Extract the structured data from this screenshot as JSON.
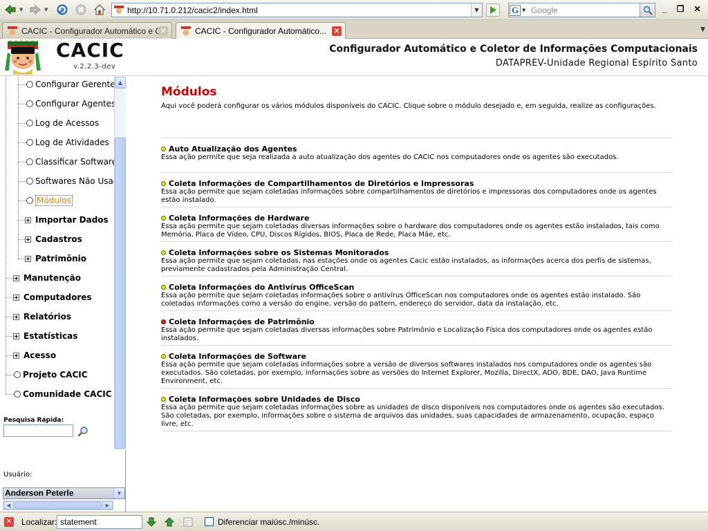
{
  "browser": {
    "url": "http://10.71.0.212/cacic2/index.html",
    "search_placeholder": "Google",
    "search_engine_letter": "G",
    "tabs": [
      {
        "label": "CACIC - Configurador Automático e C...",
        "active": false
      },
      {
        "label": "CACIC - Configurador Automático...",
        "active": true
      }
    ]
  },
  "header": {
    "brand": "CACIC",
    "version": "v.2.2.3-dev",
    "subtitle": "Configurador Automático e Coletor de Informações Computacionais",
    "org": "DATAPREV-Unidade Regional Espírito Santo"
  },
  "sidebar": {
    "items": [
      {
        "label": "Configurar Gerente",
        "type": "leaf"
      },
      {
        "label": "Configurar Agentes",
        "type": "leaf"
      },
      {
        "label": "Log de Acessos",
        "type": "leaf"
      },
      {
        "label": "Log de Atividades",
        "type": "leaf"
      },
      {
        "label": "Classificar Software",
        "type": "leaf"
      },
      {
        "label": "Softwares Não Usac",
        "type": "leaf"
      },
      {
        "label": "Módulos",
        "type": "leaf",
        "selected": true
      },
      {
        "label": "Importar Dados",
        "type": "folder"
      },
      {
        "label": "Cadastros",
        "type": "folder"
      },
      {
        "label": "Patrimônio",
        "type": "folder"
      },
      {
        "label": "Manutenção",
        "type": "folder"
      },
      {
        "label": "Computadores",
        "type": "folder"
      },
      {
        "label": "Relatórios",
        "type": "folder"
      },
      {
        "label": "Estatísticas",
        "type": "folder"
      },
      {
        "label": "Acesso",
        "type": "folder"
      },
      {
        "label": "Projeto CACIC",
        "type": "leaf"
      },
      {
        "label": "Comunidade CACIC",
        "type": "leaf"
      }
    ],
    "quick_search_label": "Pesquisa Rápida:",
    "user_label": "Usuário:",
    "user_value": "Anderson Peterle"
  },
  "main": {
    "title": "Módulos",
    "intro": "Aqui você poderá configurar os vários módulos disponíveis do CACIC. Clique sobre o módulo desejado e, em seguida, realize as configurações.",
    "modules": [
      {
        "title": "Auto Atualização dos Agentes",
        "desc": "Essa ação permite que seja realizada a auto atualização dos agentes do CACIC nos computadores onde os agentes são executados.",
        "status": "yellow"
      },
      {
        "title": "Coleta Informações de Compartilhamentos de Diretórios e Impressoras",
        "desc": "Essa ação permite que sejam coletadas informações sobre compartilhamentos de diretórios e impressoras dos computadores onde os agentes estão instalado.",
        "status": "yellow"
      },
      {
        "title": "Coleta Informações de Hardware",
        "desc": "Essa ação permite que sejam coletadas diversas informações sobre o hardware dos computadores onde os agentes estão instalados, tais como Memória, Placa de Vídeo, CPU, Discos Rígidos, BIOS, Placa de Rede, Placa Mãe, etc.",
        "status": "yellow"
      },
      {
        "title": "Coleta Informações sobre os Sistemas Monitorados",
        "desc": "Essa ação permite que sejam coletadas, nas estações onde os agentes Cacic estão instalados, as informações acerca dos perfís de sistemas, previamente cadastrados pela Administração Central.",
        "status": "yellow"
      },
      {
        "title": "Coleta Informações do Antivírus OfficeScan",
        "desc": "Essa ação permite que sejam coletadas informações sobre o antivírus OfficeScan nos computadores onde os agentes estão instalado. São coletadas informações como a versão do engine, versão do pattern, endereço do servidor, data da instalação, etc.",
        "status": "yellow"
      },
      {
        "title": "Coleta Informações de Patrimônio",
        "desc": "Essa ação permite que sejam coletadas diversas informações sobre Patrimônio e Localização Física dos computadores onde os agentes estão instalados.",
        "status": "red"
      },
      {
        "title": "Coleta Informações de Software",
        "desc": "Essa ação permite que sejam coletadas informações sobre a versão de diversos softwares instalados nos computadores onde os agentes são executados. São coletadas, por exemplo, informações sobre as versões do Internet Explorer, Mozilla, DirectX, ADO, BDE, DAO, Java Runtime Environment, etc.",
        "status": "yellow"
      },
      {
        "title": "Coleta Informações sobre Unidades de Disco",
        "desc": "Essa ação permite que sejam coletadas informações sobre as unidades de disco disponíveis nos computadores onde os agentes são executados. São coletadas, por exemplo, informações sobre o sistema de arquivos das unidades, suas capacidades de armazenamento, ocupação, espaço livre, etc.",
        "status": "yellow"
      }
    ]
  },
  "findbar": {
    "label": "Localizar:",
    "value": "statement",
    "match_case_label": "Diferenciar maiúsc./minúsc."
  },
  "colors": {
    "title_red": "#cc0000",
    "bullet_yellow": "#e6e600",
    "bullet_red": "#dd2222",
    "selected_orange": "#d28a00"
  }
}
